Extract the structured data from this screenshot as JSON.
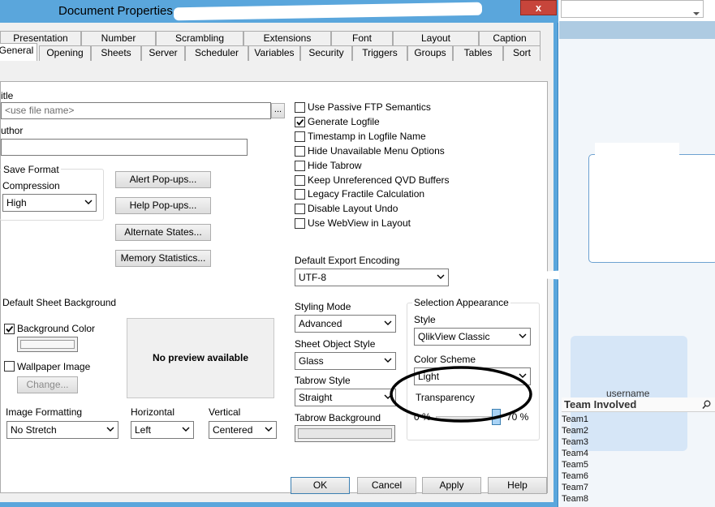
{
  "dialog": {
    "title": "Document Properties",
    "close_label": "x"
  },
  "tabs_row1": [
    "Presentation",
    "Number",
    "Scrambling",
    "Extensions",
    "Font",
    "Layout",
    "Caption"
  ],
  "tabs_row2": [
    "General",
    "Opening",
    "Sheets",
    "Server",
    "Scheduler",
    "Variables",
    "Security",
    "Triggers",
    "Groups",
    "Tables",
    "Sort"
  ],
  "active_tab": "General",
  "general": {
    "title_label": "itle",
    "title_placeholder": "<use file name>",
    "browse_label": "...",
    "author_label": "uthor",
    "author_value": "",
    "save_format": {
      "group_label": "Save Format",
      "compression_label": "Compression",
      "compression_value": "High"
    },
    "buttons": {
      "alert": "Alert Pop-ups...",
      "help": "Help Pop-ups...",
      "alternate": "Alternate States...",
      "memory": "Memory Statistics..."
    },
    "checkboxes": [
      {
        "label": "Use Passive FTP Semantics",
        "checked": false
      },
      {
        "label": "Generate Logfile",
        "checked": true
      },
      {
        "label": "Timestamp in Logfile Name",
        "checked": false
      },
      {
        "label": "Hide Unavailable Menu Options",
        "checked": false
      },
      {
        "label": "Hide Tabrow",
        "checked": false
      },
      {
        "label": "Keep Unreferenced QVD Buffers",
        "checked": false
      },
      {
        "label": "Legacy Fractile Calculation",
        "checked": false
      },
      {
        "label": "Disable Layout Undo",
        "checked": false
      },
      {
        "label": "Use WebView in Layout",
        "checked": false
      }
    ],
    "export_encoding": {
      "label": "Default Export Encoding",
      "value": "UTF-8"
    },
    "sheet_background": {
      "group_label": "Default Sheet Background",
      "background_color_label": "Background Color",
      "background_color_checked": true,
      "wallpaper_label": "Wallpaper Image",
      "wallpaper_checked": false,
      "change_label": "Change...",
      "preview_text": "No preview available",
      "image_formatting_label": "Image Formatting",
      "image_formatting_value": "No Stretch",
      "horizontal_label": "Horizontal",
      "horizontal_value": "Left",
      "vertical_label": "Vertical",
      "vertical_value": "Centered"
    },
    "styling": {
      "styling_mode_label": "Styling Mode",
      "styling_mode_value": "Advanced",
      "sheet_object_style_label": "Sheet Object Style",
      "sheet_object_style_value": "Glass",
      "tabrow_style_label": "Tabrow Style",
      "tabrow_style_value": "Straight",
      "tabrow_background_label": "Tabrow Background"
    },
    "selection_appearance": {
      "group_label": "Selection Appearance",
      "style_label": "Style",
      "style_value": "QlikView Classic",
      "color_scheme_label": "Color Scheme",
      "color_scheme_value": "Light",
      "transparency_label": "Transparency",
      "slider_min": "0 %",
      "slider_max": "70 %",
      "slider_fraction": 0.95
    }
  },
  "footer": {
    "ok": "OK",
    "cancel": "Cancel",
    "apply": "Apply",
    "help": "Help"
  },
  "right_pane": {
    "username_label": "username",
    "listbox_title": "Team Involved",
    "teams": [
      "Team1",
      "Team2",
      "Team3",
      "Team4",
      "Team5",
      "Team6",
      "Team7",
      "Team8"
    ]
  },
  "colors": {
    "titlebar": "#5aa6dc",
    "close_button": "#c7453b",
    "annotation_ellipse": "#000000",
    "slider_thumb": "#a9d3f5"
  }
}
